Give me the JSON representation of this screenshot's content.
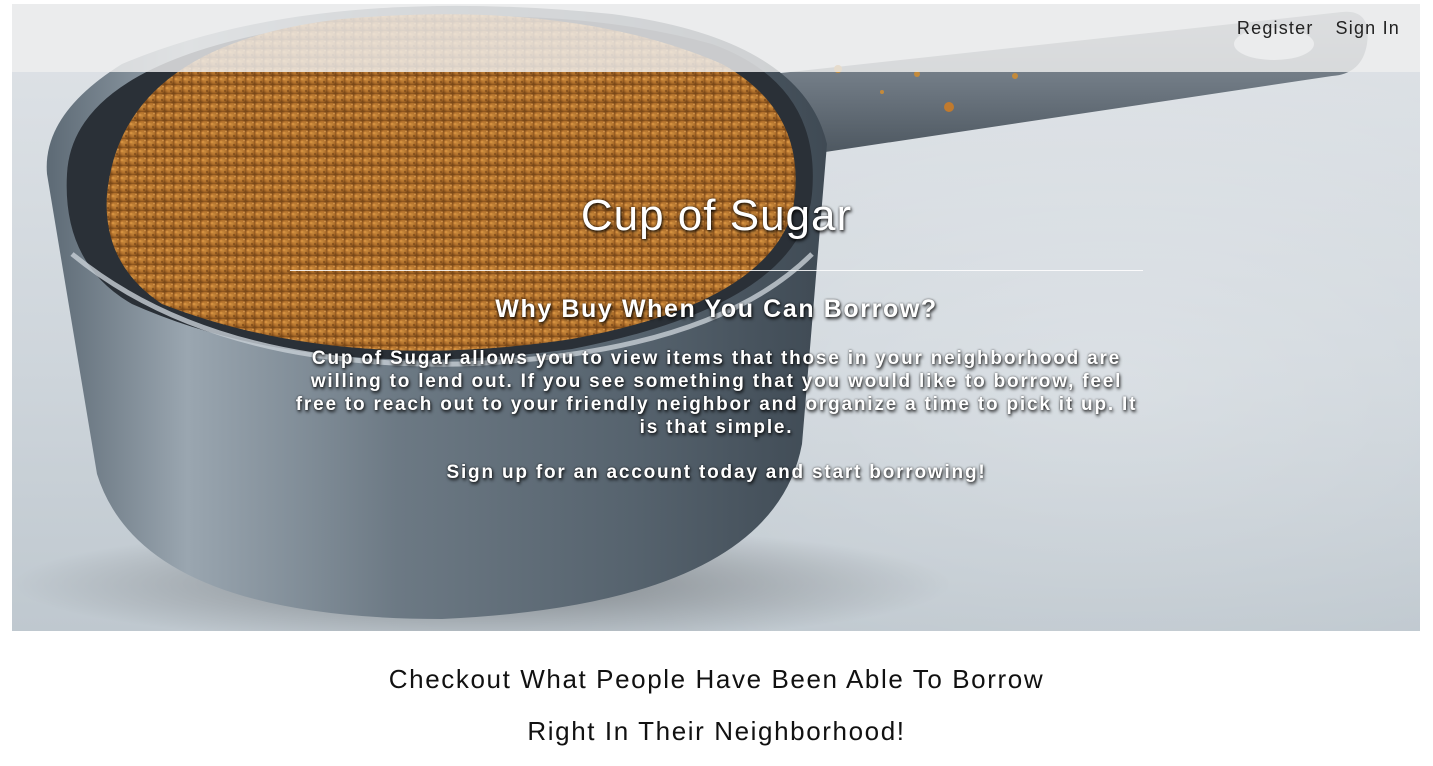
{
  "nav": {
    "register_label": "Register",
    "signin_label": "Sign In"
  },
  "hero": {
    "title": "Cup of Sugar",
    "subtitle": "Why Buy When You Can Borrow?",
    "body": "Cup of Sugar allows you to view items that those in your neighborhood are willing to lend out. If you see something that you would like to borrow, feel free to reach out to your friendly neighbor and organize a time to pick it up. It is that simple.",
    "cta": "Sign up for an account today and start borrowing!",
    "image_subject": "measuring-cup-brown-sugar"
  },
  "section": {
    "line1": "Checkout What People Have Been Able To Borrow",
    "line2": "Right In Their Neighborhood!"
  },
  "colors": {
    "hero_text": "#ffffff",
    "nav_bar": "#eeeeee",
    "body_text": "#111111",
    "sugar": "#b9742c"
  }
}
